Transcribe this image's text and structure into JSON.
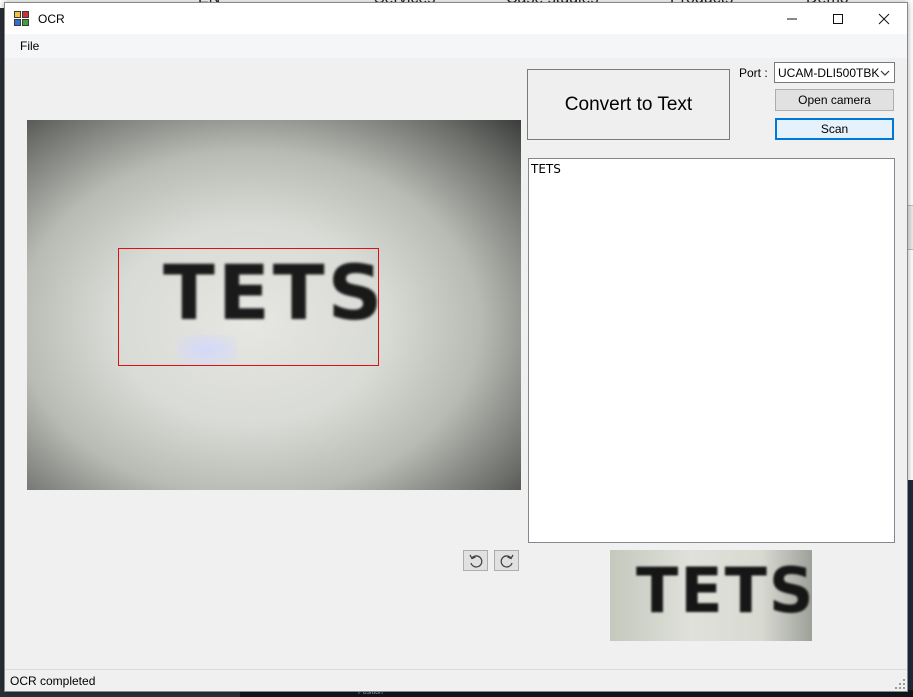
{
  "background_page": {
    "nav_items": [
      "EN",
      "Services",
      "Case studies",
      "Products",
      "Demo"
    ],
    "taskbar_text": "Position"
  },
  "window": {
    "title": "OCR",
    "controls": {
      "minimize": "—",
      "maximize": "☐",
      "close": "✕"
    }
  },
  "menu": {
    "items": [
      {
        "label": "File"
      }
    ]
  },
  "camera": {
    "captured_text": "TETS"
  },
  "controls": {
    "convert_label": "Convert to Text",
    "port_label": "Port :",
    "port_value": "UCAM-DLI500TBK",
    "open_camera_label": "Open camera",
    "scan_label": "Scan"
  },
  "result": {
    "text": "TETS"
  },
  "rotate": {
    "left_icon": "rotate-left-icon",
    "right_icon": "rotate-right-icon"
  },
  "preview": {
    "text": "TETS"
  },
  "status": {
    "text": "OCR completed"
  },
  "colors": {
    "selection_box": "#e01010",
    "focused_button_border": "#0078d7"
  }
}
